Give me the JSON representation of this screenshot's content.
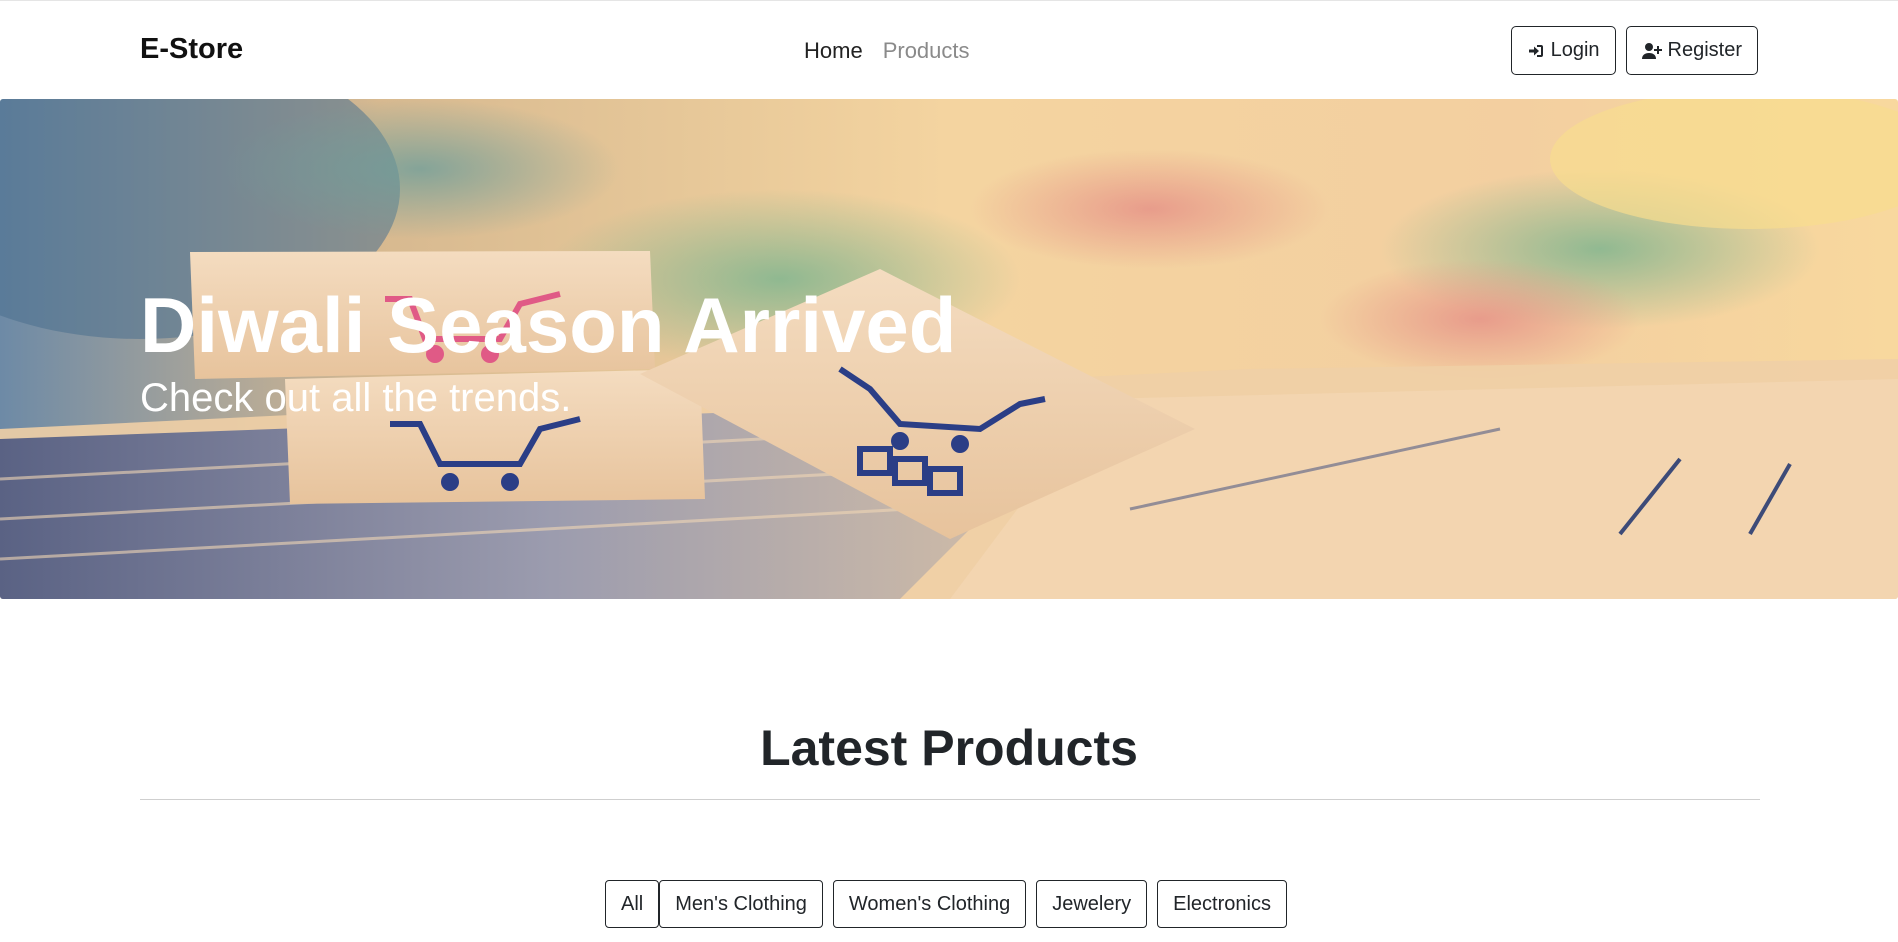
{
  "navbar": {
    "brand": "E-Store",
    "links": [
      {
        "label": "Home",
        "active": true
      },
      {
        "label": "Products",
        "active": false
      }
    ],
    "login_label": "Login",
    "register_label": "Register",
    "login_icon": "sign-in-icon",
    "register_icon": "user-plus-icon"
  },
  "hero": {
    "title": "Diwali Season Arrived",
    "subtitle": "Check out all the trends."
  },
  "latest": {
    "title": "Latest Products",
    "filters": [
      "All",
      "Men's Clothing",
      "Women's Clothing",
      "Jewelery",
      "Electronics"
    ]
  }
}
